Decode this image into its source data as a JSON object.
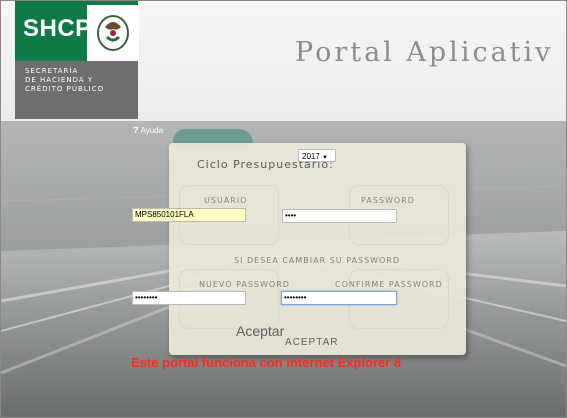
{
  "header": {
    "logo": "SHCP",
    "agency_lines": [
      "SECRETARÍA",
      "DE HACIENDA Y",
      "CRÉDITO PÚBLICO"
    ],
    "portal_title": "Portal Aplicativ"
  },
  "help": {
    "label": "Ayuda",
    "icon": "question-icon"
  },
  "form": {
    "cycle_label": "Ciclo Presupuestario:",
    "year_selected": "2017",
    "usuario_label": "Usuario",
    "usuario_value": "MPS850101FLA",
    "password_label": "Password",
    "password_value": "••••",
    "change_prompt": "Si desea cambiar su Password",
    "new_password_label": "Nuevo Password",
    "new_password_value": "••••••••",
    "confirm_password_label": "Confirme Password",
    "confirm_password_value": "••••••••",
    "accept_text": "Aceptar",
    "accept_button": "ACEPTAR"
  },
  "warning": "Este portal funciona con Internet Explorer 8",
  "colors": {
    "brand_green": "#107a45",
    "logo_gray": "#6d6e6f",
    "warning_red": "#ff2a1e",
    "tab_teal": "#6e9b93"
  }
}
